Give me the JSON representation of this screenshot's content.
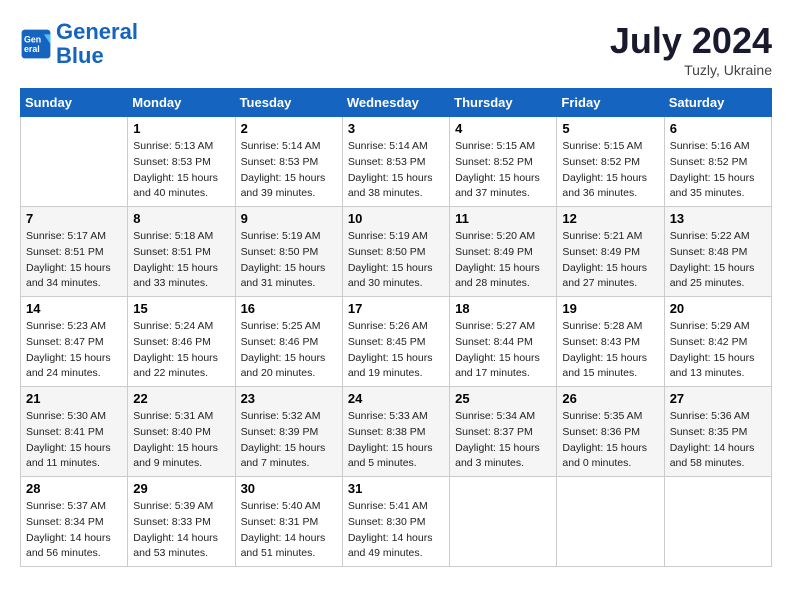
{
  "logo": {
    "line1": "General",
    "line2": "Blue"
  },
  "title": "July 2024",
  "location": "Tuzly, Ukraine",
  "weekdays": [
    "Sunday",
    "Monday",
    "Tuesday",
    "Wednesday",
    "Thursday",
    "Friday",
    "Saturday"
  ],
  "weeks": [
    [
      {
        "num": "",
        "info": ""
      },
      {
        "num": "1",
        "info": "Sunrise: 5:13 AM\nSunset: 8:53 PM\nDaylight: 15 hours\nand 40 minutes."
      },
      {
        "num": "2",
        "info": "Sunrise: 5:14 AM\nSunset: 8:53 PM\nDaylight: 15 hours\nand 39 minutes."
      },
      {
        "num": "3",
        "info": "Sunrise: 5:14 AM\nSunset: 8:53 PM\nDaylight: 15 hours\nand 38 minutes."
      },
      {
        "num": "4",
        "info": "Sunrise: 5:15 AM\nSunset: 8:52 PM\nDaylight: 15 hours\nand 37 minutes."
      },
      {
        "num": "5",
        "info": "Sunrise: 5:15 AM\nSunset: 8:52 PM\nDaylight: 15 hours\nand 36 minutes."
      },
      {
        "num": "6",
        "info": "Sunrise: 5:16 AM\nSunset: 8:52 PM\nDaylight: 15 hours\nand 35 minutes."
      }
    ],
    [
      {
        "num": "7",
        "info": "Sunrise: 5:17 AM\nSunset: 8:51 PM\nDaylight: 15 hours\nand 34 minutes."
      },
      {
        "num": "8",
        "info": "Sunrise: 5:18 AM\nSunset: 8:51 PM\nDaylight: 15 hours\nand 33 minutes."
      },
      {
        "num": "9",
        "info": "Sunrise: 5:19 AM\nSunset: 8:50 PM\nDaylight: 15 hours\nand 31 minutes."
      },
      {
        "num": "10",
        "info": "Sunrise: 5:19 AM\nSunset: 8:50 PM\nDaylight: 15 hours\nand 30 minutes."
      },
      {
        "num": "11",
        "info": "Sunrise: 5:20 AM\nSunset: 8:49 PM\nDaylight: 15 hours\nand 28 minutes."
      },
      {
        "num": "12",
        "info": "Sunrise: 5:21 AM\nSunset: 8:49 PM\nDaylight: 15 hours\nand 27 minutes."
      },
      {
        "num": "13",
        "info": "Sunrise: 5:22 AM\nSunset: 8:48 PM\nDaylight: 15 hours\nand 25 minutes."
      }
    ],
    [
      {
        "num": "14",
        "info": "Sunrise: 5:23 AM\nSunset: 8:47 PM\nDaylight: 15 hours\nand 24 minutes."
      },
      {
        "num": "15",
        "info": "Sunrise: 5:24 AM\nSunset: 8:46 PM\nDaylight: 15 hours\nand 22 minutes."
      },
      {
        "num": "16",
        "info": "Sunrise: 5:25 AM\nSunset: 8:46 PM\nDaylight: 15 hours\nand 20 minutes."
      },
      {
        "num": "17",
        "info": "Sunrise: 5:26 AM\nSunset: 8:45 PM\nDaylight: 15 hours\nand 19 minutes."
      },
      {
        "num": "18",
        "info": "Sunrise: 5:27 AM\nSunset: 8:44 PM\nDaylight: 15 hours\nand 17 minutes."
      },
      {
        "num": "19",
        "info": "Sunrise: 5:28 AM\nSunset: 8:43 PM\nDaylight: 15 hours\nand 15 minutes."
      },
      {
        "num": "20",
        "info": "Sunrise: 5:29 AM\nSunset: 8:42 PM\nDaylight: 15 hours\nand 13 minutes."
      }
    ],
    [
      {
        "num": "21",
        "info": "Sunrise: 5:30 AM\nSunset: 8:41 PM\nDaylight: 15 hours\nand 11 minutes."
      },
      {
        "num": "22",
        "info": "Sunrise: 5:31 AM\nSunset: 8:40 PM\nDaylight: 15 hours\nand 9 minutes."
      },
      {
        "num": "23",
        "info": "Sunrise: 5:32 AM\nSunset: 8:39 PM\nDaylight: 15 hours\nand 7 minutes."
      },
      {
        "num": "24",
        "info": "Sunrise: 5:33 AM\nSunset: 8:38 PM\nDaylight: 15 hours\nand 5 minutes."
      },
      {
        "num": "25",
        "info": "Sunrise: 5:34 AM\nSunset: 8:37 PM\nDaylight: 15 hours\nand 3 minutes."
      },
      {
        "num": "26",
        "info": "Sunrise: 5:35 AM\nSunset: 8:36 PM\nDaylight: 15 hours\nand 0 minutes."
      },
      {
        "num": "27",
        "info": "Sunrise: 5:36 AM\nSunset: 8:35 PM\nDaylight: 14 hours\nand 58 minutes."
      }
    ],
    [
      {
        "num": "28",
        "info": "Sunrise: 5:37 AM\nSunset: 8:34 PM\nDaylight: 14 hours\nand 56 minutes."
      },
      {
        "num": "29",
        "info": "Sunrise: 5:39 AM\nSunset: 8:33 PM\nDaylight: 14 hours\nand 53 minutes."
      },
      {
        "num": "30",
        "info": "Sunrise: 5:40 AM\nSunset: 8:31 PM\nDaylight: 14 hours\nand 51 minutes."
      },
      {
        "num": "31",
        "info": "Sunrise: 5:41 AM\nSunset: 8:30 PM\nDaylight: 14 hours\nand 49 minutes."
      },
      {
        "num": "",
        "info": ""
      },
      {
        "num": "",
        "info": ""
      },
      {
        "num": "",
        "info": ""
      }
    ]
  ]
}
